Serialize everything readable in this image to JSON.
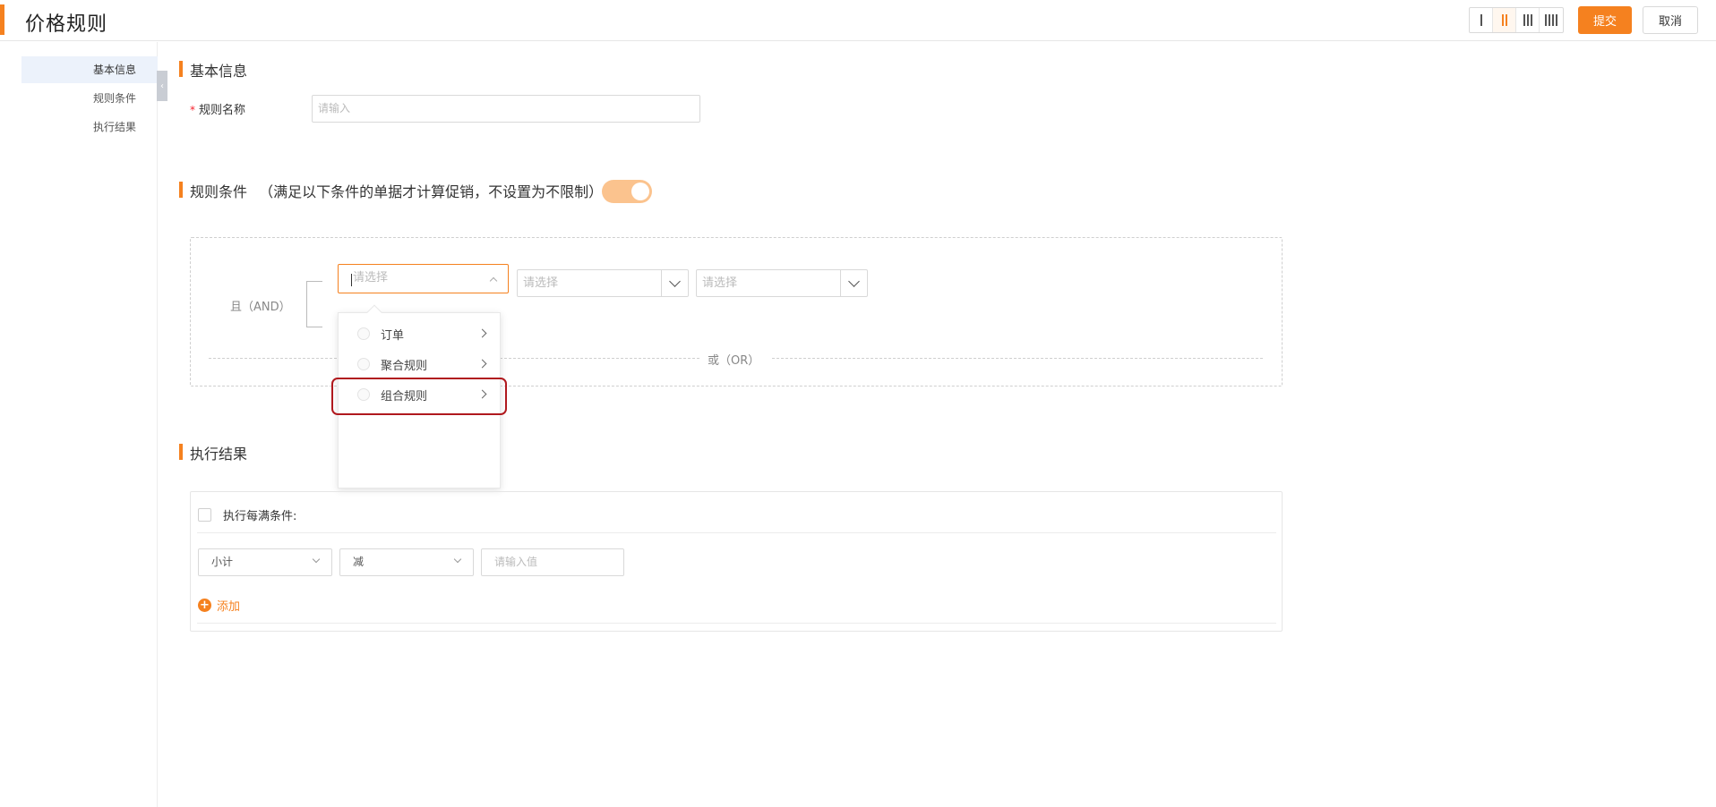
{
  "header": {
    "title": "价格规则",
    "column_modes": [
      "1-column",
      "2-column",
      "3-column",
      "4-column"
    ],
    "active_column_mode": 2,
    "submit_label": "提交",
    "cancel_label": "取消"
  },
  "sidebar": {
    "items": [
      {
        "label": "基本信息",
        "active": true
      },
      {
        "label": "规则条件",
        "active": false
      },
      {
        "label": "执行结果",
        "active": false
      }
    ]
  },
  "basic": {
    "section_title": "基本信息",
    "rule_name_label": "规则名称",
    "rule_name_placeholder": "请输入"
  },
  "conditions": {
    "section_title": "规则条件",
    "section_note": "（满足以下条件的单据才计算促销，不设置为不限制）",
    "toggle_on": true,
    "and_label": "且（AND）",
    "or_label": "或（OR）",
    "select_placeholder": "请选择",
    "select2_placeholder": "请选择",
    "select3_placeholder": "请选择",
    "dropdown_options": [
      "订单",
      "聚合规则",
      "组合规则"
    ]
  },
  "result": {
    "section_title": "执行结果",
    "each_condition_label": "执行每满条件:",
    "field_select": "小计",
    "op_select": "减",
    "value_placeholder": "请输入值",
    "add_label": "添加"
  },
  "colors": {
    "accent": "#f5811f",
    "highlight": "#b0191e"
  }
}
